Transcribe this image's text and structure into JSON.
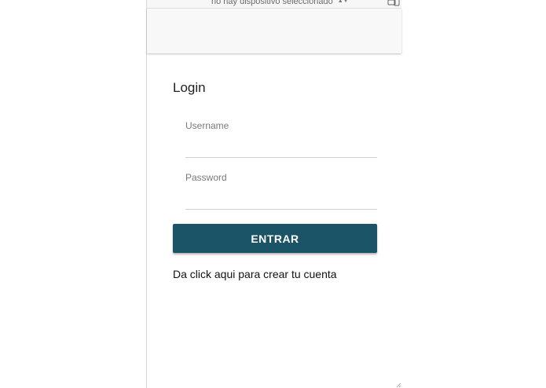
{
  "device_toolbar": {
    "device_select": "no hay dispositivo seleccionado",
    "rotate_icon": "rotate-device-icon"
  },
  "login": {
    "title": "Login",
    "username_label": "Username",
    "username_value": "",
    "password_label": "Password",
    "password_value": "",
    "submit_label": "ENTRAR",
    "signup_link": "Da click aqui para crear tu cuenta"
  },
  "colors": {
    "primary_button": "#1a5466",
    "header_bg": "#f8f8f8"
  }
}
